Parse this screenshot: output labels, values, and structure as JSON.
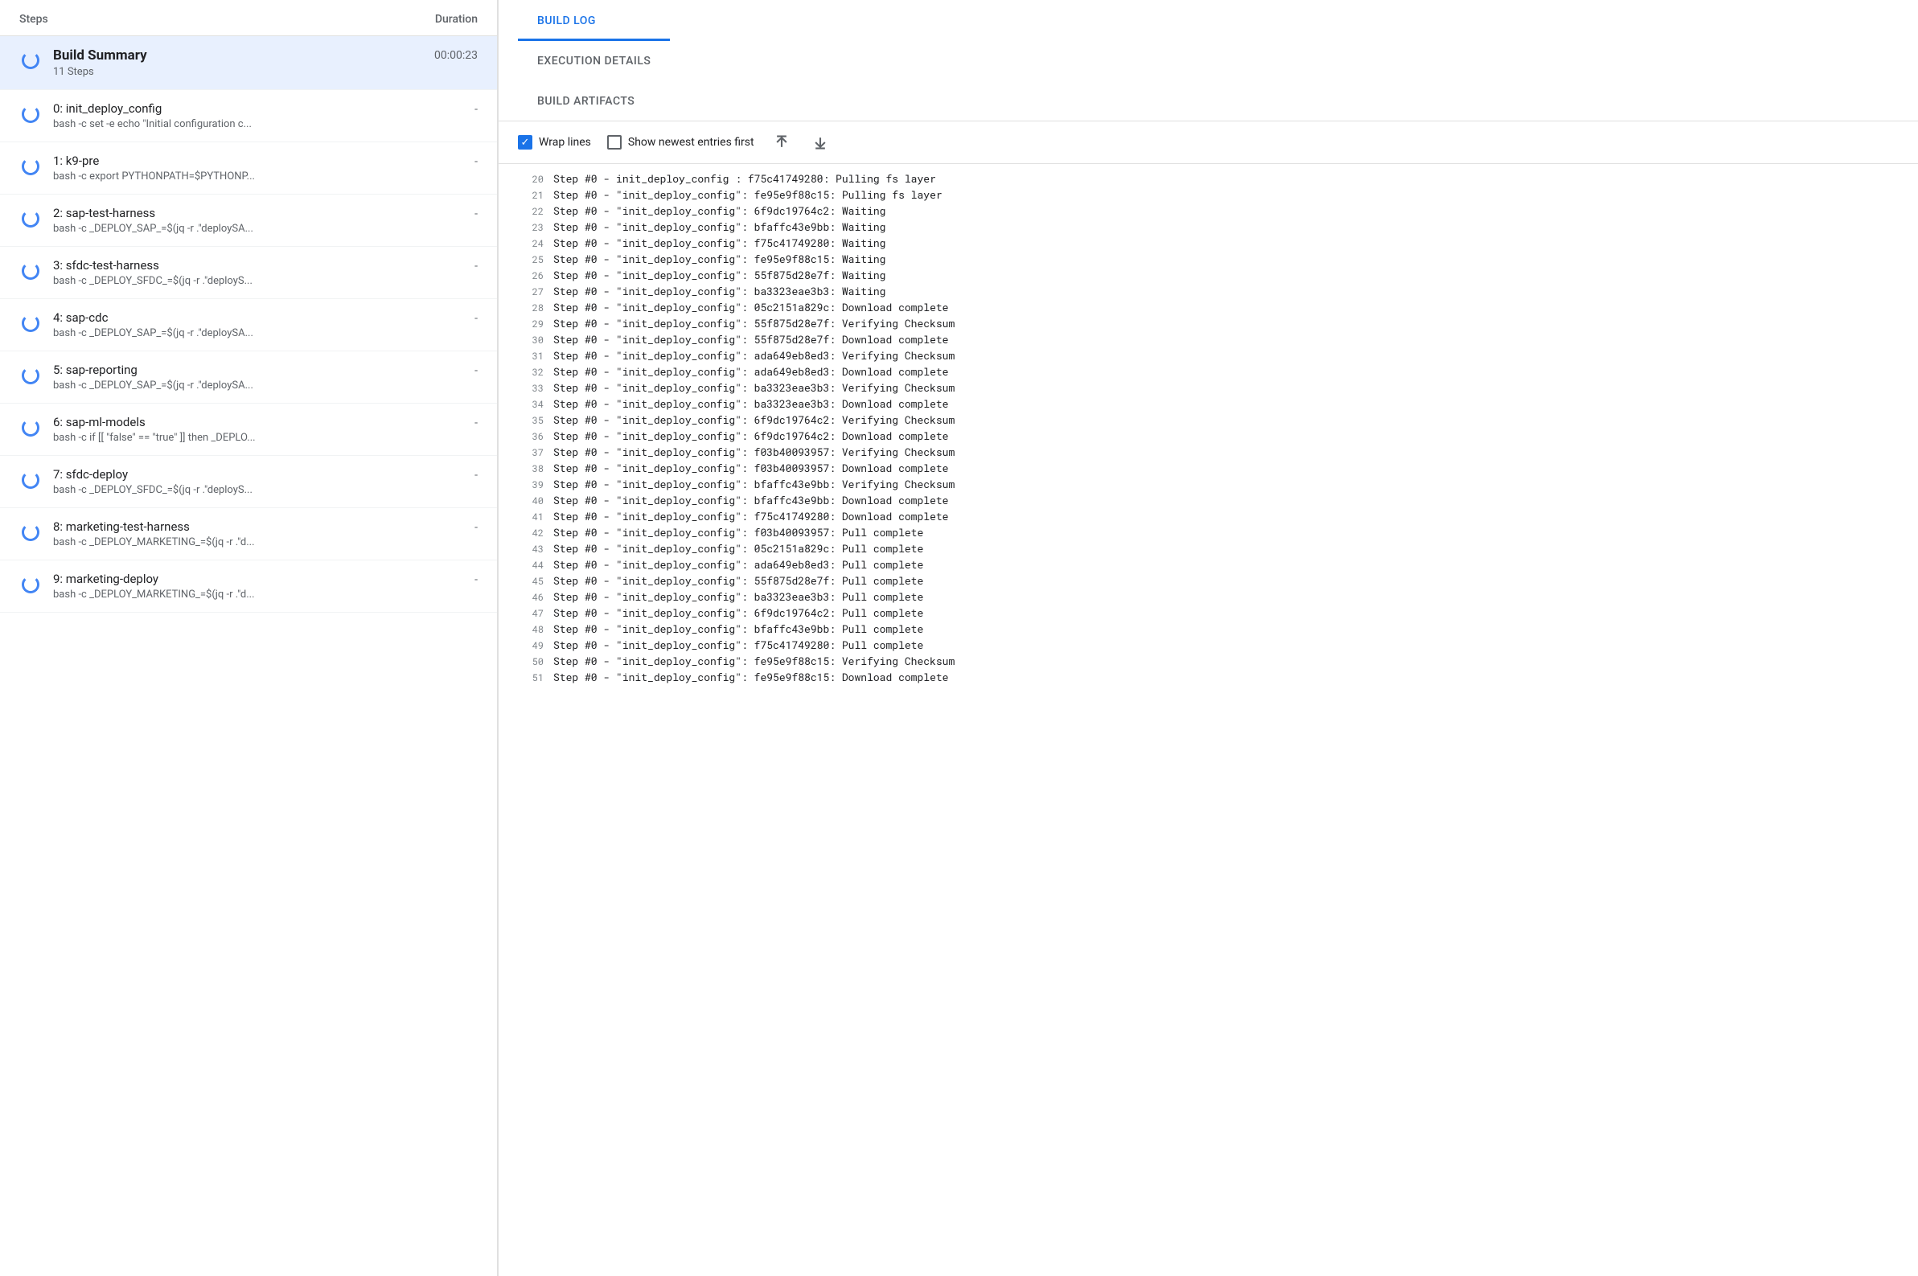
{
  "left": {
    "headers": {
      "steps": "Steps",
      "duration": "Duration"
    },
    "summary": {
      "title": "Build Summary",
      "subtitle": "11 Steps",
      "duration": "00:00:23"
    },
    "steps": [
      {
        "index": "0",
        "name": "init_deploy_config",
        "cmd": "bash -c set -e echo \"Initial configuration c...",
        "duration": "-"
      },
      {
        "index": "1",
        "name": "k9-pre",
        "cmd": "bash -c export PYTHONPATH=$PYTHONP...",
        "duration": "-"
      },
      {
        "index": "2",
        "name": "sap-test-harness",
        "cmd": "bash -c _DEPLOY_SAP_=$(jq -r .\"deploySA...",
        "duration": "-"
      },
      {
        "index": "3",
        "name": "sfdc-test-harness",
        "cmd": "bash -c _DEPLOY_SFDC_=$(jq -r .\"deployS...",
        "duration": "-"
      },
      {
        "index": "4",
        "name": "sap-cdc",
        "cmd": "bash -c _DEPLOY_SAP_=$(jq -r .\"deploySA...",
        "duration": "-"
      },
      {
        "index": "5",
        "name": "sap-reporting",
        "cmd": "bash -c _DEPLOY_SAP_=$(jq -r .\"deploySA...",
        "duration": "-"
      },
      {
        "index": "6",
        "name": "sap-ml-models",
        "cmd": "bash -c if [[ \"false\" == \"true\" ]] then _DEPLO...",
        "duration": "-"
      },
      {
        "index": "7",
        "name": "sfdc-deploy",
        "cmd": "bash -c _DEPLOY_SFDC_=$(jq -r .\"deployS...",
        "duration": "-"
      },
      {
        "index": "8",
        "name": "marketing-test-harness",
        "cmd": "bash -c _DEPLOY_MARKETING_=$(jq -r .\"d...",
        "duration": "-"
      },
      {
        "index": "9",
        "name": "marketing-deploy",
        "cmd": "bash -c _DEPLOY_MARKETING_=$(jq -r .\"d...",
        "duration": "-"
      }
    ]
  },
  "right": {
    "tabs": [
      {
        "id": "build-log",
        "label": "BUILD LOG"
      },
      {
        "id": "execution-details",
        "label": "EXECUTION DETAILS"
      },
      {
        "id": "build-artifacts",
        "label": "BUILD ARTIFACTS"
      }
    ],
    "active_tab": "build-log",
    "toolbar": {
      "wrap_lines_label": "Wrap lines",
      "show_newest_label": "Show newest entries first",
      "scroll_top_icon": "↑",
      "scroll_bottom_icon": "↓"
    },
    "log_lines": [
      {
        "num": "20",
        "text": "Step #0 -  init_deploy_config : f75c41749280: Pulling fs layer"
      },
      {
        "num": "21",
        "text": "Step #0 - \"init_deploy_config\": fe95e9f88c15: Pulling fs layer"
      },
      {
        "num": "22",
        "text": "Step #0 - \"init_deploy_config\": 6f9dc19764c2: Waiting"
      },
      {
        "num": "23",
        "text": "Step #0 - \"init_deploy_config\": bfaffc43e9bb: Waiting"
      },
      {
        "num": "24",
        "text": "Step #0 - \"init_deploy_config\": f75c41749280: Waiting"
      },
      {
        "num": "25",
        "text": "Step #0 - \"init_deploy_config\": fe95e9f88c15: Waiting"
      },
      {
        "num": "26",
        "text": "Step #0 - \"init_deploy_config\": 55f875d28e7f: Waiting"
      },
      {
        "num": "27",
        "text": "Step #0 - \"init_deploy_config\": ba3323eae3b3: Waiting"
      },
      {
        "num": "28",
        "text": "Step #0 - \"init_deploy_config\": 05c2151a829c: Download complete"
      },
      {
        "num": "29",
        "text": "Step #0 - \"init_deploy_config\": 55f875d28e7f: Verifying Checksum"
      },
      {
        "num": "30",
        "text": "Step #0 - \"init_deploy_config\": 55f875d28e7f: Download complete"
      },
      {
        "num": "31",
        "text": "Step #0 - \"init_deploy_config\": ada649eb8ed3: Verifying Checksum"
      },
      {
        "num": "32",
        "text": "Step #0 - \"init_deploy_config\": ada649eb8ed3: Download complete"
      },
      {
        "num": "33",
        "text": "Step #0 - \"init_deploy_config\": ba3323eae3b3: Verifying Checksum"
      },
      {
        "num": "34",
        "text": "Step #0 - \"init_deploy_config\": ba3323eae3b3: Download complete"
      },
      {
        "num": "35",
        "text": "Step #0 - \"init_deploy_config\": 6f9dc19764c2: Verifying Checksum"
      },
      {
        "num": "36",
        "text": "Step #0 - \"init_deploy_config\": 6f9dc19764c2: Download complete"
      },
      {
        "num": "37",
        "text": "Step #0 - \"init_deploy_config\": f03b40093957: Verifying Checksum"
      },
      {
        "num": "38",
        "text": "Step #0 - \"init_deploy_config\": f03b40093957: Download complete"
      },
      {
        "num": "39",
        "text": "Step #0 - \"init_deploy_config\": bfaffc43e9bb: Verifying Checksum"
      },
      {
        "num": "40",
        "text": "Step #0 - \"init_deploy_config\": bfaffc43e9bb: Download complete"
      },
      {
        "num": "41",
        "text": "Step #0 - \"init_deploy_config\": f75c41749280: Download complete"
      },
      {
        "num": "42",
        "text": "Step #0 - \"init_deploy_config\": f03b40093957: Pull complete"
      },
      {
        "num": "43",
        "text": "Step #0 - \"init_deploy_config\": 05c2151a829c: Pull complete"
      },
      {
        "num": "44",
        "text": "Step #0 - \"init_deploy_config\": ada649eb8ed3: Pull complete"
      },
      {
        "num": "45",
        "text": "Step #0 - \"init_deploy_config\": 55f875d28e7f: Pull complete"
      },
      {
        "num": "46",
        "text": "Step #0 - \"init_deploy_config\": ba3323eae3b3: Pull complete"
      },
      {
        "num": "47",
        "text": "Step #0 - \"init_deploy_config\": 6f9dc19764c2: Pull complete"
      },
      {
        "num": "48",
        "text": "Step #0 - \"init_deploy_config\": bfaffc43e9bb: Pull complete"
      },
      {
        "num": "49",
        "text": "Step #0 - \"init_deploy_config\": f75c41749280: Pull complete"
      },
      {
        "num": "50",
        "text": "Step #0 - \"init_deploy_config\": fe95e9f88c15: Verifying Checksum"
      },
      {
        "num": "51",
        "text": "Step #0 - \"init_deploy_config\": fe95e9f88c15: Download complete"
      }
    ]
  }
}
